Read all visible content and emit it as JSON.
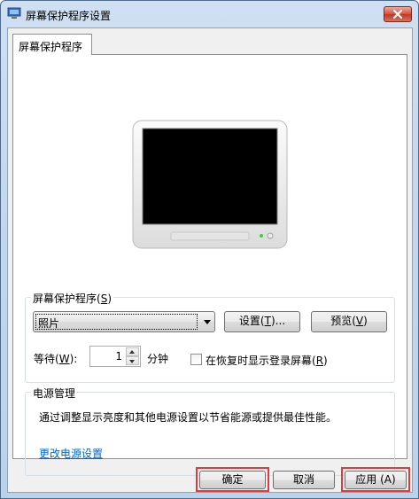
{
  "window": {
    "title": "屏幕保护程序设置",
    "icon": "screensaver-app-icon",
    "close_icon": "close-icon"
  },
  "tabs": [
    {
      "label": "屏幕保护程序"
    }
  ],
  "screensaver": {
    "group_label": "屏幕保护程序(",
    "group_label_key": "S",
    "group_label_end": ")",
    "selected": "照片",
    "settings_button": "设置(",
    "settings_key": "T",
    "settings_end": ")...",
    "preview_button": "预览(",
    "preview_key": "V",
    "preview_end": ")",
    "wait_label": "等待(",
    "wait_key": "W",
    "wait_end": "):",
    "wait_value": "1",
    "minutes_label": "分钟",
    "resume_checkbox_label": "在恢复时显示登录屏幕(",
    "resume_key": "R",
    "resume_end": ")",
    "resume_checked": false
  },
  "power": {
    "group_label": "电源管理",
    "description": "通过调整显示亮度和其他电源设置以节省能源或提供最佳性能。",
    "link": "更改电源设置"
  },
  "footer": {
    "ok": "确定",
    "cancel": "取消",
    "apply": "应用",
    "apply_key": "(A)"
  },
  "colors": {
    "highlight_frame": "#e03a3a",
    "link": "#0066cc"
  }
}
